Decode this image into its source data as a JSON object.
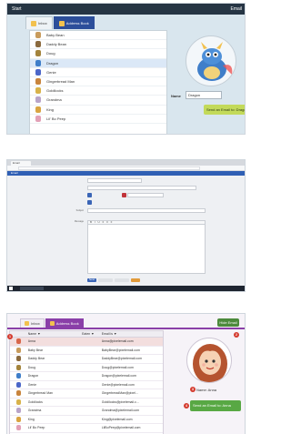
{
  "panel1": {
    "topbar": {
      "start_label": "Start",
      "email_label": "Email"
    },
    "tabs": [
      {
        "label": "Inbox"
      },
      {
        "label": "Address Book"
      }
    ],
    "contacts": [
      {
        "name": "Baby Bean",
        "color": "#c89b5c"
      },
      {
        "name": "Daddy Bean",
        "color": "#8b6a3e"
      },
      {
        "name": "Doug",
        "color": "#a3833c"
      },
      {
        "name": "Dragon",
        "color": "#3f7ec9"
      },
      {
        "name": "Genie",
        "color": "#4b66c8"
      },
      {
        "name": "Gingerbread Man",
        "color": "#c8843c"
      },
      {
        "name": "Goldilocks",
        "color": "#d8b24a"
      },
      {
        "name": "Grandma",
        "color": "#b8a4c9"
      },
      {
        "name": "King",
        "color": "#d9a441"
      },
      {
        "name": "Lil' Bo Peep",
        "color": "#e2a0b6"
      }
    ],
    "selected_index": 3,
    "detail": {
      "name_label": "Name",
      "name_value": "Dragon",
      "send_label": "Send an Email to: Dragon"
    }
  },
  "panel2": {
    "browser_tab": "Email",
    "url": "",
    "app_title": "Email",
    "labels": {
      "from": "",
      "to": "",
      "cc": "",
      "subject": "Subject",
      "message": "Message"
    },
    "fields": {
      "from": "",
      "to": "",
      "cc": "",
      "subject": ""
    },
    "toolbar_glyphs": "B I U ≡ ≡ ≡",
    "actions": [
      {
        "label": "Send"
      },
      {
        "label": ""
      },
      {
        "label": ""
      },
      {
        "label": ""
      }
    ],
    "taskbar_item": ""
  },
  "panel3": {
    "tabs": [
      {
        "label": "Inbox"
      },
      {
        "label": "Address Book"
      }
    ],
    "hide_button": "Hide Email",
    "columns": {
      "name": "Name ▼",
      "eaten": "Eaten ▼",
      "email": "Email is ▼"
    },
    "rows": [
      {
        "name": "Anna",
        "eaten": "",
        "email": "Anna@pixelemail.com",
        "color": "#d8664a"
      },
      {
        "name": "Baby Bear",
        "eaten": "",
        "email": "BabyBear@pixelemail.com",
        "color": "#c89b5c"
      },
      {
        "name": "Daddy Bear",
        "eaten": "",
        "email": "DaddyBear@pixelemail.com",
        "color": "#8b6a3e"
      },
      {
        "name": "Doug",
        "eaten": "",
        "email": "Doug@pixelemail.com",
        "color": "#a3833c"
      },
      {
        "name": "Dragon",
        "eaten": "",
        "email": "Dragon@pixelemail.com",
        "color": "#3f7ec9"
      },
      {
        "name": "Genie",
        "eaten": "",
        "email": "Genie@pixelemail.com",
        "color": "#4b66c8"
      },
      {
        "name": "Gingerbread Man",
        "eaten": "",
        "email": "GingerbreadMan@pixel...",
        "color": "#c8843c"
      },
      {
        "name": "Goldilocks",
        "eaten": "",
        "email": "Goldilocks@pixelemail.c...",
        "color": "#d8b24a"
      },
      {
        "name": "Grandma",
        "eaten": "",
        "email": "Grandma@pixelemail.com",
        "color": "#b8a4c9"
      },
      {
        "name": "King",
        "eaten": "",
        "email": "King@pixelemail.com",
        "color": "#d9a441"
      },
      {
        "name": "Lil' Bo Peep",
        "eaten": "",
        "email": "LilBoPeep@pixelemail.com",
        "color": "#e2a0b6"
      }
    ],
    "selected_index": 0,
    "badges": {
      "b1": "1",
      "b2": "2",
      "b3": "3",
      "b4": "4"
    },
    "detail": {
      "name_text": "Name: Anna",
      "send_label": "Send an Email to: Anna"
    }
  }
}
